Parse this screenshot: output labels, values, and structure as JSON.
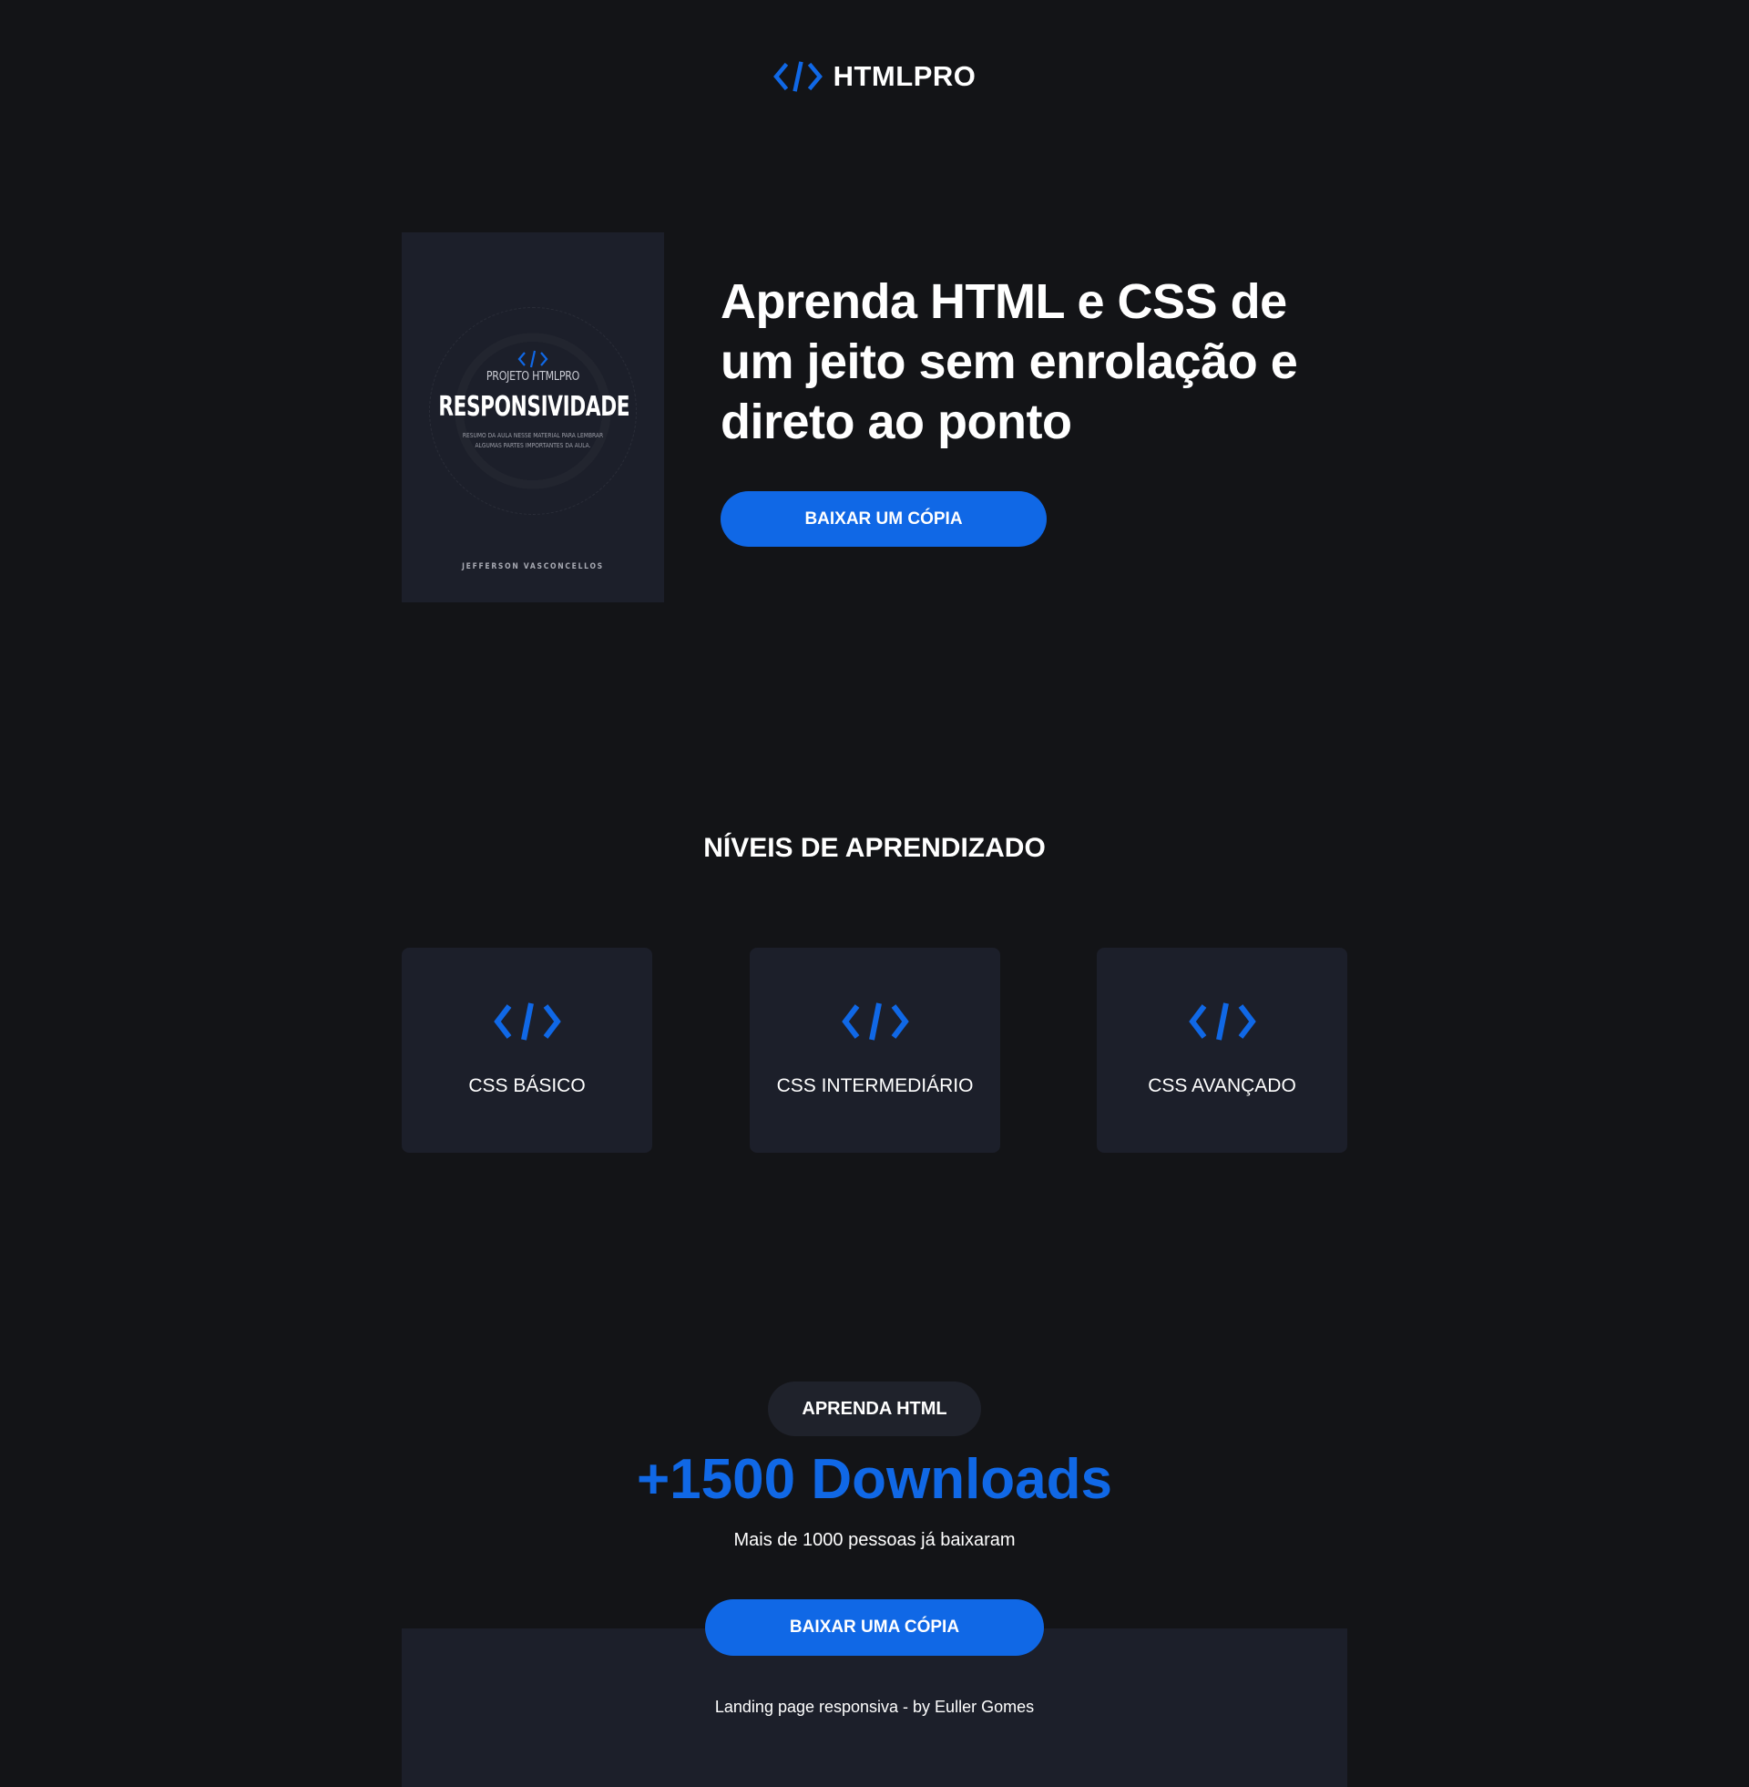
{
  "colors": {
    "background": "#131417",
    "card": "#1c1f2a",
    "accent": "#1068e6",
    "text": "#ffffff"
  },
  "header": {
    "logo_icon": "code-brackets-icon",
    "brand": "HTMLPRO"
  },
  "hero": {
    "cover": {
      "project": "PROJETO HTMLPRO",
      "title": "RESPONSIVIDADE",
      "description": "RESUMO DA AULA NESSE MATERIAL PARA LEMBRAR ALGUMAS PARTES IMPORTANTES DA AULA.",
      "author": "JEFFERSON VASCONCELLOS"
    },
    "title": "Aprenda HTML e CSS de um jeito sem enrolação e direto ao ponto",
    "button": "BAIXAR UM CÓPIA"
  },
  "levels": {
    "title": "NÍVEIS DE APRENDIZADO",
    "cards": [
      {
        "icon": "code-brackets-icon",
        "label": "CSS BÁSICO"
      },
      {
        "icon": "code-brackets-icon",
        "label": "CSS INTERMEDIÁRIO"
      },
      {
        "icon": "code-brackets-icon",
        "label": "CSS AVANÇADO"
      }
    ]
  },
  "downloads": {
    "badge": "APRENDA HTML",
    "title": "+1500 Downloads",
    "subtitle": "Mais de 1000 pessoas já baixaram",
    "button": "BAIXAR UMA CÓPIA"
  },
  "footer": {
    "text": "Landing page responsiva - by Euller Gomes"
  }
}
